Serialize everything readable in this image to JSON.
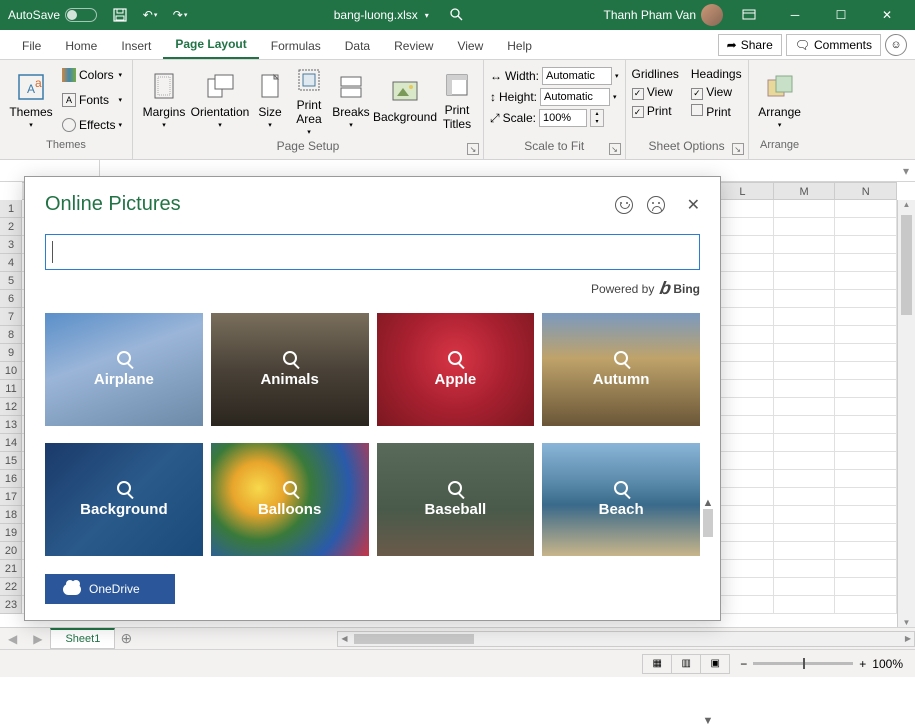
{
  "titlebar": {
    "autosave_label": "AutoSave",
    "filename": "bang-luong.xlsx",
    "username": "Thanh Pham Van"
  },
  "tabs": {
    "file": "File",
    "home": "Home",
    "insert": "Insert",
    "page_layout": "Page Layout",
    "formulas": "Formulas",
    "data": "Data",
    "review": "Review",
    "view": "View",
    "help": "Help",
    "share": "Share",
    "comments": "Comments"
  },
  "ribbon": {
    "themes": {
      "label": "Themes",
      "themes_btn": "Themes",
      "colors": "Colors",
      "fonts": "Fonts",
      "effects": "Effects"
    },
    "page_setup": {
      "label": "Page Setup",
      "margins": "Margins",
      "orientation": "Orientation",
      "size": "Size",
      "print_area": "Print\nArea",
      "breaks": "Breaks",
      "background": "Background",
      "print_titles": "Print\nTitles"
    },
    "scale": {
      "label": "Scale to Fit",
      "width": "Width:",
      "height": "Height:",
      "scale": "Scale:",
      "width_val": "Automatic",
      "height_val": "Automatic",
      "scale_val": "100%"
    },
    "sheet_options": {
      "label": "Sheet Options",
      "gridlines": "Gridlines",
      "headings": "Headings",
      "view": "View",
      "print": "Print"
    },
    "arrange": {
      "label": "Arrange",
      "btn": "Arrange"
    }
  },
  "columns": [
    "L",
    "M",
    "N"
  ],
  "sheet_tab": "Sheet1",
  "zoom": "100%",
  "dialog": {
    "title": "Online Pictures",
    "powered": "Powered by",
    "bing": "Bing",
    "onedrive": "OneDrive",
    "categories": [
      {
        "label": "Airplane",
        "bg": "bg-airplane"
      },
      {
        "label": "Animals",
        "bg": "bg-animals"
      },
      {
        "label": "Apple",
        "bg": "bg-apple"
      },
      {
        "label": "Autumn",
        "bg": "bg-autumn"
      },
      {
        "label": "Background",
        "bg": "bg-background"
      },
      {
        "label": "Balloons",
        "bg": "bg-balloons"
      },
      {
        "label": "Baseball",
        "bg": "bg-baseball"
      },
      {
        "label": "Beach",
        "bg": "bg-beach"
      }
    ]
  }
}
